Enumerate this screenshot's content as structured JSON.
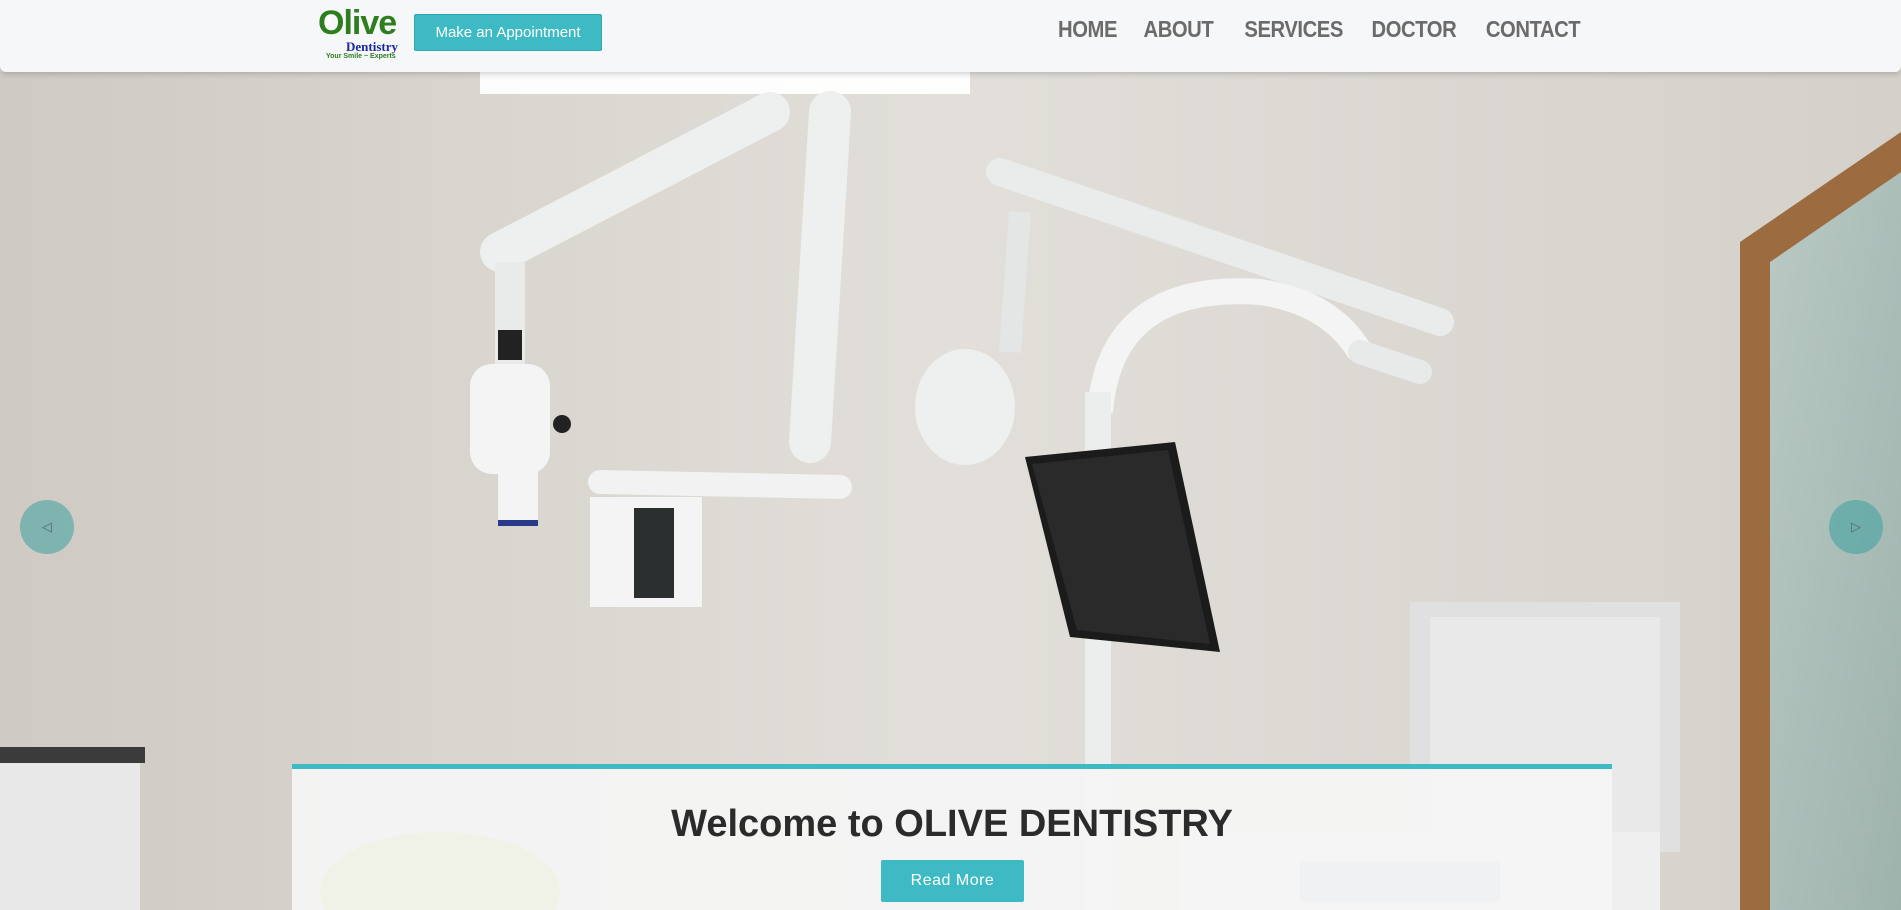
{
  "logo": {
    "name": "Olive",
    "sub": "Dentistry",
    "tagline": "Your Smile ~ Experts"
  },
  "header": {
    "appointment_label": "Make an Appointment"
  },
  "nav": {
    "items": [
      "HOME",
      "ABOUT",
      "SERVICES",
      "DOCTOR",
      "CONTACT"
    ]
  },
  "hero": {
    "title": "Welcome to OLIVE DENTISTRY",
    "button_label": "Read More",
    "prev_icon": "chevron-left-icon",
    "next_icon": "chevron-right-icon"
  },
  "colors": {
    "accent": "#3dbac4",
    "logo_green": "#2e7d1e",
    "logo_blue": "#1a2a9c"
  }
}
